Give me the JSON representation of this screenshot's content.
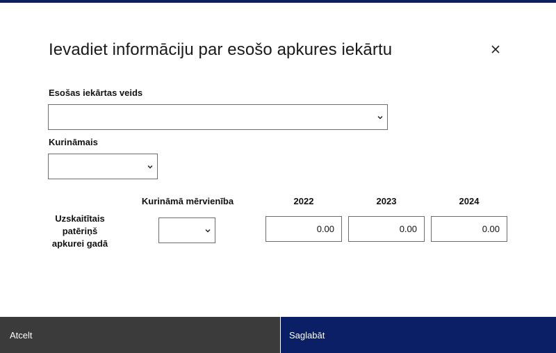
{
  "dialog": {
    "title": "Ievadiet informāciju par esošo apkures iekārtu",
    "close_icon": "close-icon"
  },
  "fields": {
    "device_type": {
      "label": "Esošas iekārtas veids",
      "value": ""
    },
    "fuel": {
      "label": "Kurināmais",
      "value": ""
    }
  },
  "consumption": {
    "row_label": "Uzskaitītais patēriņš apkurei gadā",
    "unit_header": "Kurināmā mērvienība",
    "unit_value": "",
    "years": [
      {
        "year": "2022",
        "value": "0.00"
      },
      {
        "year": "2023",
        "value": "0.00"
      },
      {
        "year": "2024",
        "value": "0.00"
      }
    ]
  },
  "footer": {
    "cancel_label": "Atcelt",
    "save_label": "Saglabāt"
  },
  "colors": {
    "accent": "#0b1f66",
    "cancel_bg": "#3b3b3b"
  }
}
